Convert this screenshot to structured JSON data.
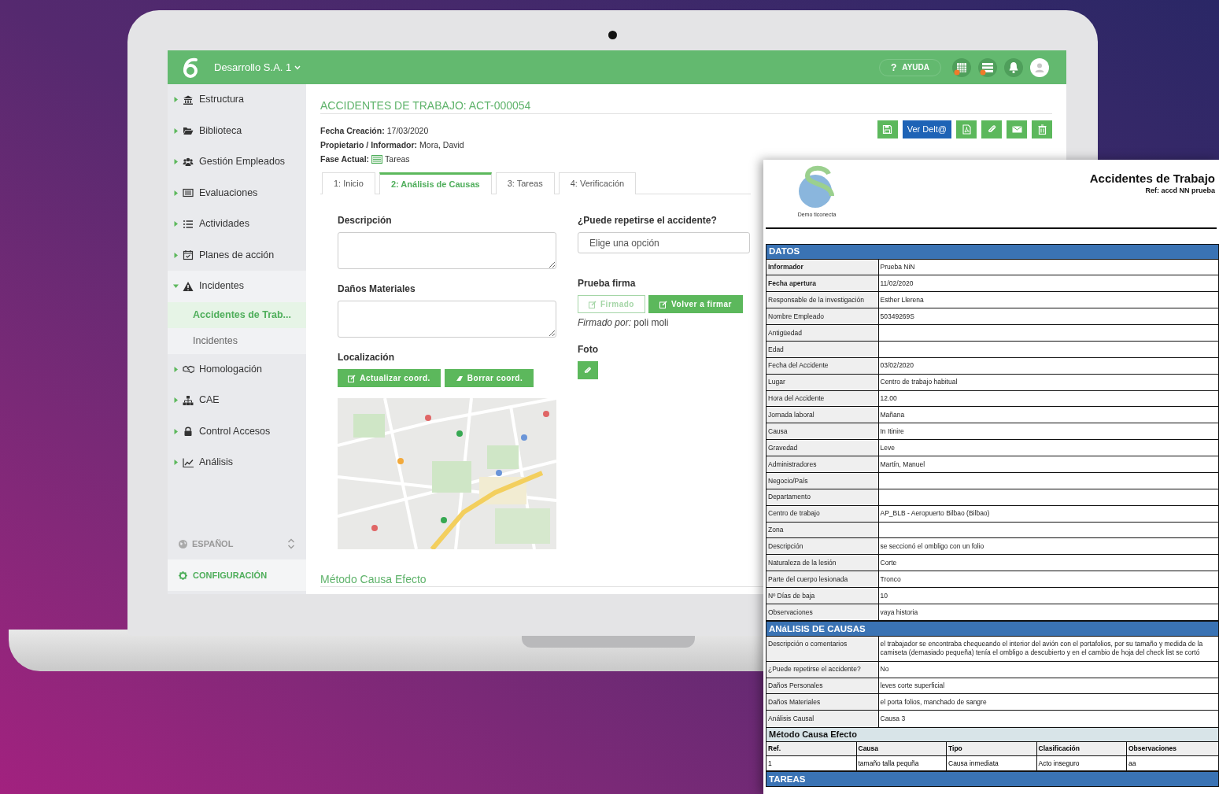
{
  "app": {
    "company": "Desarrollo S.A. 1",
    "help": {
      "mark": "?",
      "label": "AYUDA"
    },
    "sidebar": {
      "items": [
        {
          "label": "Estructura",
          "expanded": false
        },
        {
          "label": "Biblioteca",
          "expanded": false
        },
        {
          "label": "Gestión Empleados",
          "expanded": false
        },
        {
          "label": "Evaluaciones",
          "expanded": false
        },
        {
          "label": "Actividades",
          "expanded": false
        },
        {
          "label": "Planes de acción",
          "expanded": false
        },
        {
          "label": "Incidentes",
          "expanded": true,
          "children": [
            {
              "label": "Accidentes de Trab...",
              "selected": true
            },
            {
              "label": "Incidentes",
              "selected": false
            }
          ]
        },
        {
          "label": "Homologación",
          "expanded": false
        },
        {
          "label": "CAE",
          "expanded": false
        },
        {
          "label": "Control Accesos",
          "expanded": false
        },
        {
          "label": "Análisis",
          "expanded": false
        }
      ],
      "language": "ESPAÑOL",
      "settings": "CONFIGURACIÓN"
    },
    "page": {
      "title": "ACCIDENTES DE TRABAJO: ACT-000054",
      "meta": [
        {
          "label": "Fecha Creación:",
          "value": "17/03/2020"
        },
        {
          "label": "Propietario / Informador:",
          "value": "Mora, David"
        },
        {
          "label": "Fase Actual:",
          "value": "Tareas"
        }
      ],
      "view_button": "Ver Delt@",
      "tabs": [
        {
          "label": "1: Inicio",
          "selected": false
        },
        {
          "label": "2: Análisis de Causas",
          "selected": true
        },
        {
          "label": "3: Tareas",
          "selected": false
        },
        {
          "label": "4: Verificación",
          "selected": false
        }
      ],
      "left_fields": [
        {
          "kind": "textarea",
          "label": "Descripción"
        },
        {
          "kind": "textarea",
          "label": "Daños Materiales"
        },
        {
          "kind": "location",
          "label": "Localización",
          "buttons": [
            "Actualizar coord.",
            "Borrar coord."
          ]
        }
      ],
      "right_fields": [
        {
          "kind": "select",
          "label": "¿Puede repetirse el accidente?",
          "placeholder": "Elige una opción"
        },
        {
          "kind": "signature",
          "label": "Prueba firma",
          "buttons": [
            {
              "label": "Firmado",
              "disabled": true
            },
            {
              "label": "Volver a firmar",
              "disabled": false
            }
          ],
          "signed_by": "*Firmado por:* poli moli"
        },
        {
          "kind": "photo",
          "label": "Foto"
        }
      ],
      "section_title": "Método Causa Efecto"
    }
  },
  "document": {
    "logo_caption": "Demo ticonecta",
    "title": "Accidentes de Trabajo",
    "ref": "Ref: accd NN prueba",
    "sections": [
      {
        "kind": "rows",
        "title": "DATOS",
        "rows": [
          {
            "label": "Informador",
            "value": "Prueba NiN",
            "bold": true
          },
          {
            "label": "Fecha apertura",
            "value": "11/02/2020",
            "bold": true
          },
          {
            "label": "Responsable de la investigación",
            "value": "Esther Llerena",
            "bold": false
          },
          {
            "label": "Nombre Empleado",
            "value": "50349269S",
            "bold": false
          },
          {
            "label": "Antigüedad",
            "bold": false
          },
          {
            "label": "Edad",
            "bold": false
          },
          {
            "label": "Fecha del Accidente",
            "value": "03/02/2020",
            "bold": false
          },
          {
            "label": "Lugar",
            "value": "Centro de trabajo habitual",
            "bold": false
          },
          {
            "label": "Hora del Accidente",
            "value": "12.00",
            "bold": false
          },
          {
            "label": "Jornada laboral",
            "value": "Mañana",
            "bold": false
          },
          {
            "label": "Causa",
            "value": "In Itinire",
            "bold": false
          },
          {
            "label": "Gravedad",
            "value": "Leve",
            "bold": false
          },
          {
            "label": "Administradores",
            "value": "Martín, Manuel",
            "bold": false
          },
          {
            "label": "Negocio/País",
            "bold": false
          },
          {
            "label": "Departamento",
            "bold": false
          },
          {
            "label": "Centro de trabajo",
            "value": "AP_BLB - Aeropuerto Bilbao (Bilbao)",
            "bold": false
          },
          {
            "label": "Zona",
            "bold": false
          },
          {
            "label": "Descripción",
            "value": "se seccionó el ombligo con un folio",
            "bold": false
          },
          {
            "label": "Naturaleza de la lesión",
            "value": "Corte",
            "bold": false
          },
          {
            "label": "Parte del cuerpo lesionada",
            "value": "Tronco",
            "bold": false
          },
          {
            "label": "Nº Días de baja",
            "value": "10",
            "bold": false
          },
          {
            "label": "Observaciones",
            "value": "vaya historia",
            "bold": false
          }
        ]
      },
      {
        "kind": "rows",
        "title": "ANáLISIS DE CAUSAS",
        "rows": [
          {
            "label": "Descripción o comentarios",
            "value": "el trabajador se encontraba chequeando el interior del avión con el portafolios, por su tamaño y medida de la camiseta (demasiado pequeña) tenía el ombligo a descubierto y en el cambio de hoja del check list se cortó",
            "bold": false
          },
          {
            "label": "¿Puede repetirse el accidente?",
            "value": "No",
            "bold": false
          },
          {
            "label": "Daños Personales",
            "value": "leves corte superficial",
            "bold": false
          },
          {
            "label": "Daños Materiales",
            "value": "el porta folios, manchado de sangre",
            "bold": false
          },
          {
            "label": "Análisis Causal",
            "value": "Causa 3",
            "bold": false
          }
        ]
      },
      {
        "kind": "table",
        "title": "Método Causa Efecto",
        "columns": [
          "Ref.",
          "Causa",
          "Tipo",
          "Clasificación",
          "Observaciones"
        ],
        "rows": [
          [
            "1",
            "tamaño talla pequña",
            "Causa inmediata",
            "Acto inseguro",
            "aa"
          ]
        ]
      },
      {
        "kind": "rows",
        "title": "TAREAS"
      }
    ]
  }
}
